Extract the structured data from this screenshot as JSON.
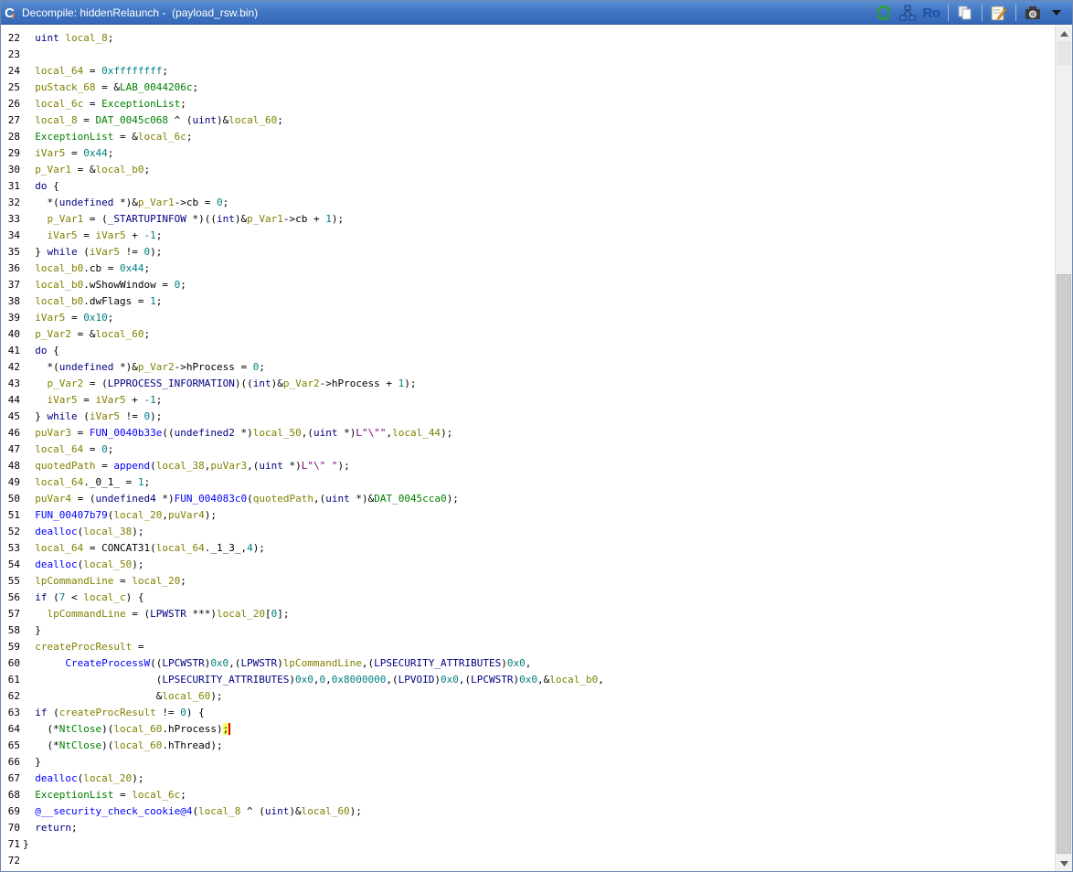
{
  "window": {
    "title": "Decompile: hiddenRelaunch -  (payload_rsw.bin)"
  },
  "toolbar": {
    "ro_label": "Ro"
  },
  "code": {
    "lines": [
      {
        "n": "22",
        "html": "  <span class=\"ty\">uint</span> <span class=\"var\">local_8</span>;"
      },
      {
        "n": "23",
        "html": ""
      },
      {
        "n": "24",
        "html": "  <span class=\"var\">local_64</span> = <span class=\"num\">0xffffffff</span>;"
      },
      {
        "n": "25",
        "html": "  <span class=\"var\">puStack_68</span> = &amp;<span class=\"gl\">LAB_0044206c</span>;"
      },
      {
        "n": "26",
        "html": "  <span class=\"var\">local_6c</span> = <span class=\"gl\">ExceptionList</span>;"
      },
      {
        "n": "27",
        "html": "  <span class=\"var\">local_8</span> = <span class=\"gl\">DAT_0045c068</span> ^ (<span class=\"ty\">uint</span>)&amp;<span class=\"var\">local_60</span>;"
      },
      {
        "n": "28",
        "html": "  <span class=\"gl\">ExceptionList</span> = &amp;<span class=\"var\">local_6c</span>;"
      },
      {
        "n": "29",
        "html": "  <span class=\"var\">iVar5</span> = <span class=\"num\">0x44</span>;"
      },
      {
        "n": "30",
        "html": "  <span class=\"var\">p_Var1</span> = &amp;<span class=\"var\">local_b0</span>;"
      },
      {
        "n": "31",
        "html": "  <span class=\"kw\">do</span> {"
      },
      {
        "n": "32",
        "html": "    *(<span class=\"ty\">undefined</span> *)&amp;<span class=\"var\">p_Var1</span>-&gt;cb = <span class=\"num\">0</span>;"
      },
      {
        "n": "33",
        "html": "    <span class=\"var\">p_Var1</span> = (<span class=\"ty\">_STARTUPINFOW</span> *)((<span class=\"ty\">int</span>)&amp;<span class=\"var\">p_Var1</span>-&gt;cb + <span class=\"num\">1</span>);"
      },
      {
        "n": "34",
        "html": "    <span class=\"var\">iVar5</span> = <span class=\"var\">iVar5</span> + <span class=\"num\">-1</span>;"
      },
      {
        "n": "35",
        "html": "  } <span class=\"kw\">while</span> (<span class=\"var\">iVar5</span> != <span class=\"num\">0</span>);"
      },
      {
        "n": "36",
        "html": "  <span class=\"var\">local_b0</span>.cb = <span class=\"num\">0x44</span>;"
      },
      {
        "n": "37",
        "html": "  <span class=\"var\">local_b0</span>.wShowWindow = <span class=\"num\">0</span>;"
      },
      {
        "n": "38",
        "html": "  <span class=\"var\">local_b0</span>.dwFlags = <span class=\"num\">1</span>;"
      },
      {
        "n": "39",
        "html": "  <span class=\"var\">iVar5</span> = <span class=\"num\">0x10</span>;"
      },
      {
        "n": "40",
        "html": "  <span class=\"var\">p_Var2</span> = &amp;<span class=\"var\">local_60</span>;"
      },
      {
        "n": "41",
        "html": "  <span class=\"kw\">do</span> {"
      },
      {
        "n": "42",
        "html": "    *(<span class=\"ty\">undefined</span> *)&amp;<span class=\"var\">p_Var2</span>-&gt;hProcess = <span class=\"num\">0</span>;"
      },
      {
        "n": "43",
        "html": "    <span class=\"var\">p_Var2</span> = (<span class=\"ty\">LPPROCESS_INFORMATION</span>)((<span class=\"ty\">int</span>)&amp;<span class=\"var\">p_Var2</span>-&gt;hProcess + <span class=\"num\">1</span>);"
      },
      {
        "n": "44",
        "html": "    <span class=\"var\">iVar5</span> = <span class=\"var\">iVar5</span> + <span class=\"num\">-1</span>;"
      },
      {
        "n": "45",
        "html": "  } <span class=\"kw\">while</span> (<span class=\"var\">iVar5</span> != <span class=\"num\">0</span>);"
      },
      {
        "n": "46",
        "html": "  <span class=\"var\">puVar3</span> = <span class=\"fn\">FUN_0040b33e</span>((<span class=\"ty\">undefined2</span> *)<span class=\"var\">local_50</span>,(<span class=\"ty\">uint</span> *)<span class=\"str\">L\"\\\"\"</span>,<span class=\"var\">local_44</span>);"
      },
      {
        "n": "47",
        "html": "  <span class=\"var\">local_64</span> = <span class=\"num\">0</span>;"
      },
      {
        "n": "48",
        "html": "  <span class=\"var\">quotedPath</span> = <span class=\"fn\">append</span>(<span class=\"var\">local_38</span>,<span class=\"var\">puVar3</span>,(<span class=\"ty\">uint</span> *)<span class=\"str\">L\"\\\" \"</span>);"
      },
      {
        "n": "49",
        "html": "  <span class=\"var\">local_64</span>._0_1_ = <span class=\"num\">1</span>;"
      },
      {
        "n": "50",
        "html": "  <span class=\"var\">puVar4</span> = (<span class=\"ty\">undefined4</span> *)<span class=\"fn\">FUN_004083c0</span>(<span class=\"var\">quotedPath</span>,(<span class=\"ty\">uint</span> *)&amp;<span class=\"gl\">DAT_0045cca0</span>);"
      },
      {
        "n": "51",
        "html": "  <span class=\"fn\">FUN_00407b79</span>(<span class=\"var\">local_20</span>,<span class=\"var\">puVar4</span>);"
      },
      {
        "n": "52",
        "html": "  <span class=\"fn\">dealloc</span>(<span class=\"var\">local_38</span>);"
      },
      {
        "n": "53",
        "html": "  <span class=\"var\">local_64</span> = CONCAT31(<span class=\"var\">local_64</span>._1_3_,<span class=\"num\">4</span>);"
      },
      {
        "n": "54",
        "html": "  <span class=\"fn\">dealloc</span>(<span class=\"var\">local_50</span>);"
      },
      {
        "n": "55",
        "html": "  <span class=\"var\">lpCommandLine</span> = <span class=\"var\">local_20</span>;"
      },
      {
        "n": "56",
        "html": "  <span class=\"kw\">if</span> (<span class=\"num\">7</span> &lt; <span class=\"var\">local_c</span>) {"
      },
      {
        "n": "57",
        "html": "    <span class=\"var\">lpCommandLine</span> = (<span class=\"ty\">LPWSTR</span> ***)<span class=\"var\">local_20</span>[<span class=\"num\">0</span>];"
      },
      {
        "n": "58",
        "html": "  }"
      },
      {
        "n": "59",
        "html": "  <span class=\"var\">createProcResult</span> ="
      },
      {
        "n": "60",
        "html": "       <span class=\"fn\">CreateProcessW</span>((<span class=\"ty\">LPCWSTR</span>)<span class=\"num\">0x0</span>,(<span class=\"ty\">LPWSTR</span>)<span class=\"var\">lpCommandLine</span>,(<span class=\"ty\">LPSECURITY_ATTRIBUTES</span>)<span class=\"num\">0x0</span>,"
      },
      {
        "n": "61",
        "html": "                      (<span class=\"ty\">LPSECURITY_ATTRIBUTES</span>)<span class=\"num\">0x0</span>,<span class=\"num\">0</span>,<span class=\"num\">0x8000000</span>,(<span class=\"ty\">LPVOID</span>)<span class=\"num\">0x0</span>,(<span class=\"ty\">LPCWSTR</span>)<span class=\"num\">0x0</span>,&amp;<span class=\"var\">local_b0</span>,"
      },
      {
        "n": "62",
        "html": "                      &amp;<span class=\"var\">local_60</span>);"
      },
      {
        "n": "63",
        "html": "  <span class=\"kw\">if</span> (<span class=\"var\">createProcResult</span> != <span class=\"num\">0</span>) {"
      },
      {
        "n": "64",
        "html": "    (*<span class=\"gl\">NtClose</span>)(<span class=\"var\">local_60</span>.hProcess)<span class=\"cursor\">;</span>"
      },
      {
        "n": "65",
        "html": "    (*<span class=\"gl\">NtClose</span>)(<span class=\"var\">local_60</span>.hThread);"
      },
      {
        "n": "66",
        "html": "  }"
      },
      {
        "n": "67",
        "html": "  <span class=\"fn\">dealloc</span>(<span class=\"var\">local_20</span>);"
      },
      {
        "n": "68",
        "html": "  <span class=\"gl\">ExceptionList</span> = <span class=\"var\">local_6c</span>;"
      },
      {
        "n": "69",
        "html": "  <span class=\"fn\">@__security_check_cookie@4</span>(<span class=\"var\">local_8</span> ^ (<span class=\"ty\">uint</span>)&amp;<span class=\"var\">local_60</span>);"
      },
      {
        "n": "70",
        "html": "  <span class=\"kw\">return</span>;"
      },
      {
        "n": "71",
        "html": "}"
      },
      {
        "n": "72",
        "html": ""
      }
    ]
  }
}
